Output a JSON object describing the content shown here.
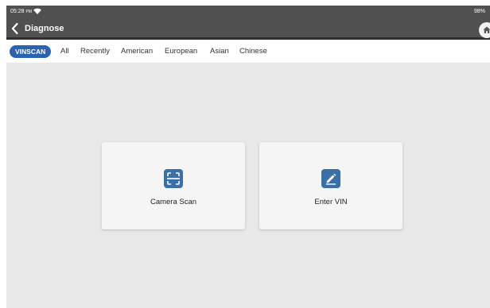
{
  "status_bar": {
    "time": "05:28",
    "ampm": "PM",
    "battery": "98%"
  },
  "header": {
    "title": "Diagnose"
  },
  "tabs": [
    {
      "label": "VINSCAN",
      "active": true
    },
    {
      "label": "All",
      "active": false
    },
    {
      "label": "Recently",
      "active": false
    },
    {
      "label": "American",
      "active": false
    },
    {
      "label": "European",
      "active": false
    },
    {
      "label": "Asian",
      "active": false
    },
    {
      "label": "Chinese",
      "active": false
    }
  ],
  "cards": [
    {
      "label": "Camera Scan",
      "icon": "camera-scan-icon"
    },
    {
      "label": "Enter VIN",
      "icon": "edit-icon"
    }
  ],
  "colors": {
    "accent": "#2b63b0",
    "icon": "#3b6fa8",
    "header": "#505050",
    "background": "#e8e8e8"
  }
}
